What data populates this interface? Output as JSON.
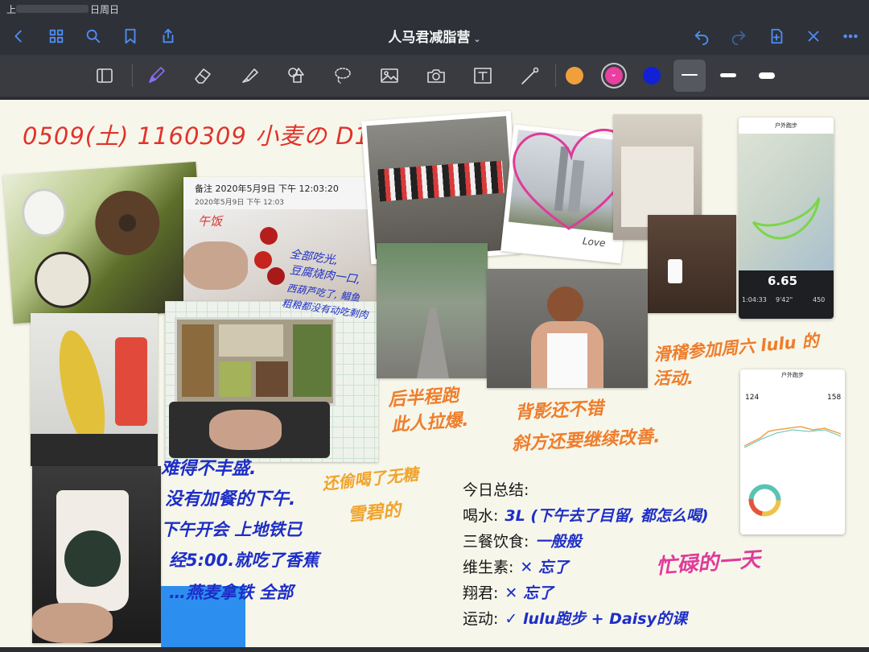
{
  "status": {
    "left_text": "上",
    "right_text": "日周日"
  },
  "app": {
    "title": "人马君减脂营"
  },
  "colors": {
    "accent": "#4d8ef7",
    "swatch_orange": "#f0a03a",
    "swatch_pink": "#e83fa0",
    "swatch_blue": "#1221d6"
  },
  "icons": {
    "nav": [
      "back-icon",
      "grid-icon",
      "search-icon",
      "bookmark-icon",
      "share-icon"
    ],
    "actions": [
      "undo-icon",
      "redo-icon",
      "add-page-icon",
      "close-icon",
      "more-icon"
    ],
    "tools": [
      "sidebar-icon",
      "pen-icon",
      "eraser-icon",
      "highlighter-icon",
      "shapes-icon",
      "lasso-icon",
      "image-icon",
      "camera-icon",
      "text-icon",
      "laser-icon"
    ]
  },
  "note": {
    "header": "0509(土) 1160309 小麦の D13",
    "timestamp": "备注 2020年5月9日 下午 12:03:20",
    "timestamp_small": "2020年5月9日 下午 12:03",
    "lunch_tag": "午饭",
    "lunch_note": [
      "全部吃光,",
      "豆腐烧肉一口,",
      "西葫芦吃了, 鲳鱼",
      "粗粮都没有动吃剩肉"
    ],
    "heart_caption": "Love",
    "pic_caption_1": [
      "后半程跑",
      "此人拉爆."
    ],
    "pic_caption_2": [
      "背影还不错",
      "斜方还要继续改善."
    ],
    "lulu_caption": [
      "滑稽参加周六 lulu 的",
      "活动."
    ],
    "dinner_note": [
      "难得不丰盛.",
      "没有加餐的下午.",
      "下午开会 上地铁已",
      "经5:00.就吃了香蕉",
      "…燕麦拿铁 全部"
    ],
    "drink_note": [
      "还偷喝了无糖",
      "雪碧的"
    ],
    "busy_note": "忙碌的一天",
    "run_distance": "6.65",
    "run_time": "1:04:33",
    "run_pace": "9'42\"",
    "run_kcal": "450",
    "phone_title": "户外跑步",
    "hr_avg": "124",
    "hr_max": "158"
  },
  "summary": {
    "title": "今日总结:",
    "rows": [
      {
        "label": "喝水:",
        "value": "3L (下午去了目留, 都怎么喝)"
      },
      {
        "label": "三餐饮食:",
        "value": "一般般"
      },
      {
        "label": "维生素:",
        "value": "✕ 忘了"
      },
      {
        "label": "翔君:",
        "value": "✕ 忘了"
      },
      {
        "label": "运动:",
        "value": "✓ lulu跑步 + Daisy的课"
      }
    ]
  }
}
